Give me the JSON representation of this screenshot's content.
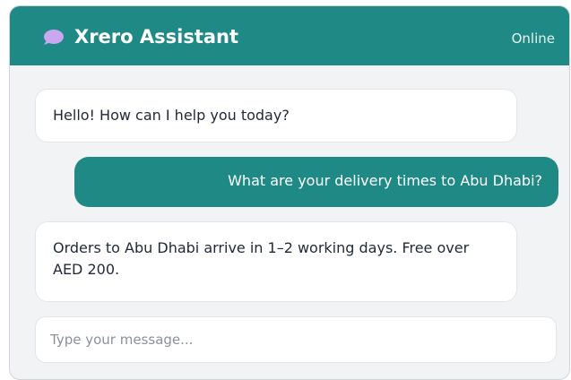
{
  "header": {
    "icon": "chat-bubble-icon",
    "title": "Xrero Assistant",
    "status": "Online"
  },
  "messages": [
    {
      "sender": "bot",
      "text": "Hello! How can I help you today?"
    },
    {
      "sender": "user",
      "text": "What are your delivery times to Abu Dhabi?"
    },
    {
      "sender": "bot",
      "text": "Orders to Abu Dhabi arrive in 1–2 working days. Free over AED 200."
    }
  ],
  "input": {
    "value": "",
    "placeholder": "Type your message..."
  },
  "colors": {
    "accent": "#1f8a85",
    "icon": "#c9a8f0",
    "panel_bg": "#f1f3f4",
    "bubble_bot_bg": "#ffffff"
  }
}
